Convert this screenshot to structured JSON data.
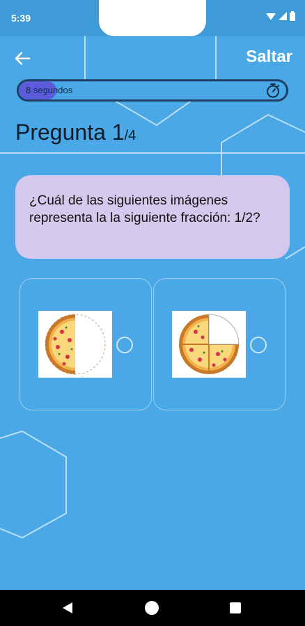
{
  "status_bar": {
    "time": "5:39"
  },
  "header": {
    "skip_label": "Saltar"
  },
  "timer": {
    "label": "8 segundos",
    "progress_fraction": 0.14
  },
  "question": {
    "title_prefix": "Pregunta 1",
    "title_suffix": "/4",
    "text": "¿Cuál de las siguientes imágenes representa la la siguiente fracción: 1/2?"
  },
  "options": [
    {
      "name": "half-pizza",
      "fraction": "1/2",
      "icon": "half-pizza-image"
    },
    {
      "name": "three-quarter-pizza",
      "fraction": "3/4",
      "icon": "three-quarter-pizza-image"
    }
  ],
  "colors": {
    "background": "#4aa8e6",
    "question_card": "#d4c8ec",
    "timer_fill": "#5b5bdc"
  }
}
